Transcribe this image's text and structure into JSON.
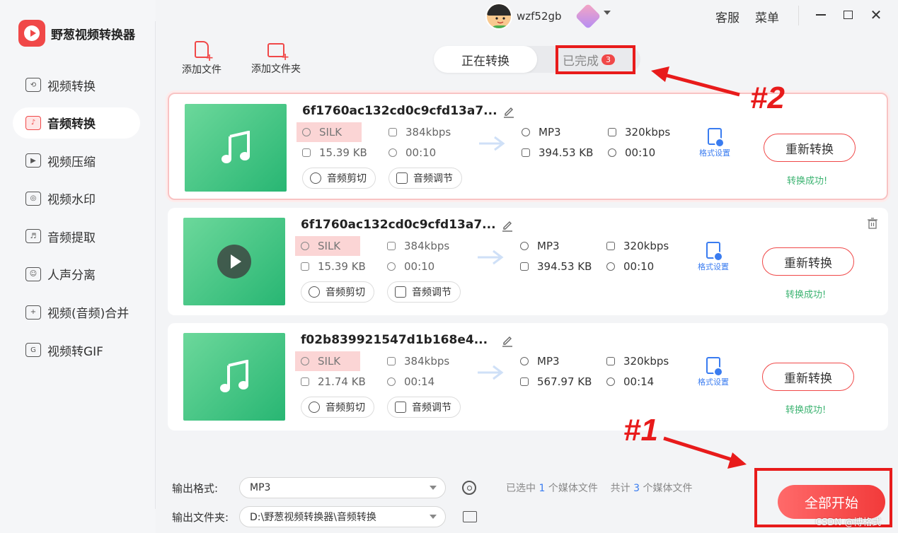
{
  "app": {
    "title": "野葱视频转换器"
  },
  "sidebar": {
    "items": [
      {
        "label": "视频转换",
        "icon": "video-convert-icon",
        "glyph": "⟲"
      },
      {
        "label": "音频转换",
        "icon": "audio-convert-icon",
        "glyph": "♪",
        "active": true
      },
      {
        "label": "视频压缩",
        "icon": "video-compress-icon",
        "glyph": "▶"
      },
      {
        "label": "视频水印",
        "icon": "watermark-icon",
        "glyph": "◎"
      },
      {
        "label": "音频提取",
        "icon": "audio-extract-icon",
        "glyph": "♬"
      },
      {
        "label": "人声分离",
        "icon": "voice-separate-icon",
        "glyph": "☺"
      },
      {
        "label": "视频(音频)合并",
        "icon": "merge-icon",
        "glyph": "+"
      },
      {
        "label": "视频转GIF",
        "icon": "gif-icon",
        "glyph": "G"
      }
    ]
  },
  "header": {
    "username": "wzf52gb",
    "service": "客服",
    "menu": "菜单",
    "close_glyph": "✕"
  },
  "toolbar": {
    "add_file": "添加文件",
    "add_folder": "添加文件夹"
  },
  "tabs": {
    "converting": "正在转换",
    "done": "已完成",
    "done_count": "3"
  },
  "annotations": {
    "label1": "#1",
    "label2": "#2"
  },
  "files": [
    {
      "name": "6f1760ac132cd0c9cfd13a7...",
      "thumb": "music-note",
      "src_format": "SILK",
      "src_bitrate": "384kbps",
      "src_size": "15.39 KB",
      "src_duration": "00:10",
      "dst_format": "MP3",
      "dst_bitrate": "320kbps",
      "dst_size": "394.53 KB",
      "dst_duration": "00:10",
      "cut_label": "音频剪切",
      "adjust_label": "音频调节",
      "format_settings": "格式设置",
      "reconvert": "重新转换",
      "status": "转换成功!"
    },
    {
      "name": "6f1760ac132cd0c9cfd13a7...",
      "thumb": "play",
      "src_format": "SILK",
      "src_bitrate": "384kbps",
      "src_size": "15.39 KB",
      "src_duration": "00:10",
      "dst_format": "MP3",
      "dst_bitrate": "320kbps",
      "dst_size": "394.53 KB",
      "dst_duration": "00:10",
      "cut_label": "音频剪切",
      "adjust_label": "音频调节",
      "format_settings": "格式设置",
      "reconvert": "重新转换",
      "status": "转换成功!"
    },
    {
      "name": "f02b839921547d1b168e4...",
      "thumb": "music-note",
      "src_format": "SILK",
      "src_bitrate": "384kbps",
      "src_size": "21.74 KB",
      "src_duration": "00:14",
      "dst_format": "MP3",
      "dst_bitrate": "320kbps",
      "dst_size": "567.97 KB",
      "dst_duration": "00:14",
      "cut_label": "音频剪切",
      "adjust_label": "音频调节",
      "format_settings": "格式设置",
      "reconvert": "重新转换",
      "status": "转换成功!"
    }
  ],
  "bottom": {
    "output_format_label": "输出格式:",
    "output_format": "MP3",
    "output_folder_label": "输出文件夹:",
    "output_folder": "D:\\野葱视频转换器\\音频转换",
    "selected_prefix": "已选中",
    "selected_count": "1",
    "selected_suffix": "个媒体文件",
    "total_prefix": "共计",
    "total_count": "3",
    "total_suffix": "个媒体文件",
    "start_all": "全部开始"
  },
  "watermark": "CSDN @博格式",
  "colors": {
    "accent": "#f04848",
    "link": "#3a7cf0",
    "success": "#3cb371",
    "annotation": "#e81b1b"
  }
}
